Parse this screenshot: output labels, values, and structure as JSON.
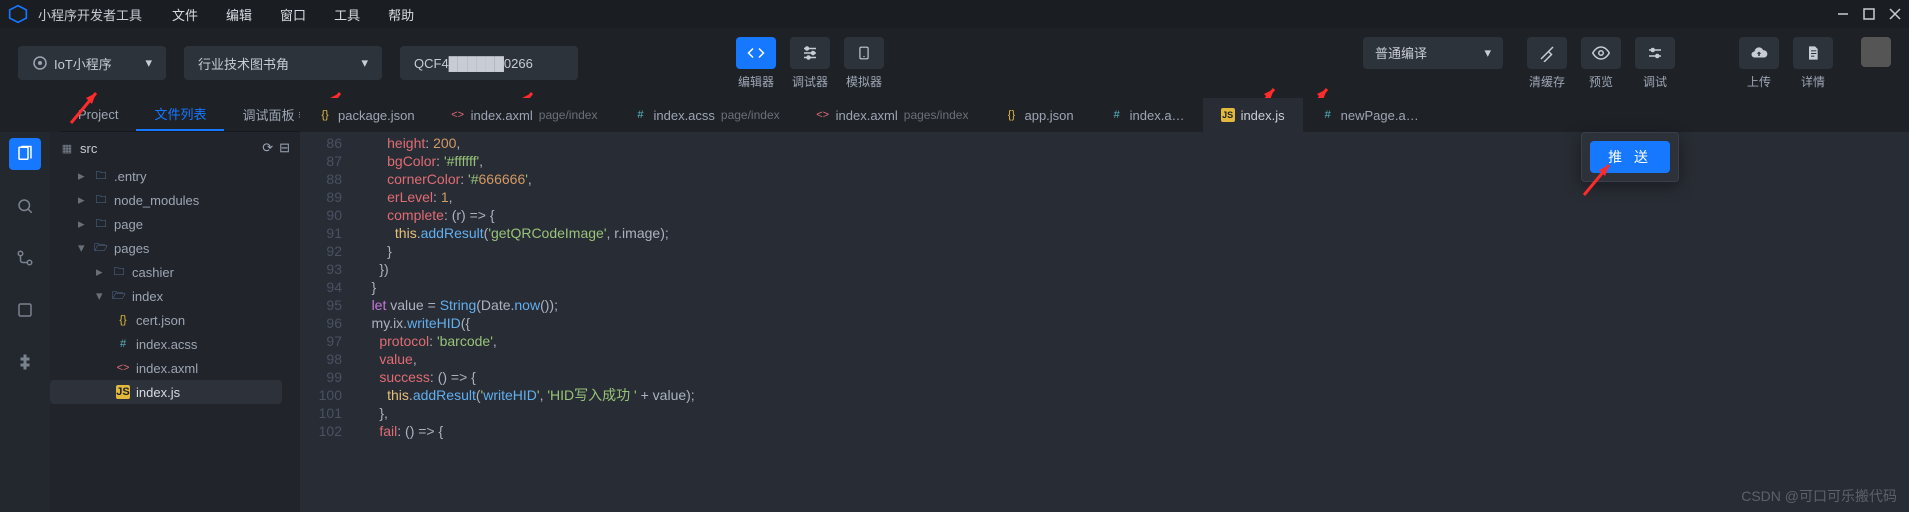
{
  "titlebar": {
    "title": "小程序开发者工具",
    "menus": [
      "文件",
      "编辑",
      "窗口",
      "工具",
      "帮助"
    ]
  },
  "toolbar": {
    "platform": "IoT小程序",
    "project": "行业技术图书角",
    "appid_masked": "QCF4██████0266",
    "center": [
      {
        "id": "editor",
        "label": "编辑器",
        "primary": true
      },
      {
        "id": "debugger",
        "label": "调试器"
      },
      {
        "id": "simulator",
        "label": "模拟器"
      }
    ],
    "compile_mode": "普通编译",
    "right": [
      {
        "id": "clear-cache",
        "label": "清缓存"
      },
      {
        "id": "preview",
        "label": "预览"
      },
      {
        "id": "debug",
        "label": "调试"
      }
    ],
    "far": [
      {
        "id": "upload",
        "label": "上传"
      },
      {
        "id": "details",
        "label": "详情"
      }
    ]
  },
  "proj_tabs": {
    "project": "Project",
    "filelist": "文件列表",
    "debugpanel": "调试面板"
  },
  "editor_tabs": [
    {
      "icon": "braces",
      "label": "package.json"
    },
    {
      "icon": "tag",
      "label": "index.axml",
      "sub": "page/index"
    },
    {
      "icon": "hash",
      "label": "index.acss",
      "sub": "page/index"
    },
    {
      "icon": "tag",
      "label": "index.axml",
      "sub": "pages/index"
    },
    {
      "icon": "braces",
      "label": "app.json"
    },
    {
      "icon": "hash",
      "label": "index.a…"
    },
    {
      "icon": "js",
      "label": "index.js",
      "active": true
    },
    {
      "icon": "hash",
      "label": "newPage.a…"
    }
  ],
  "file_tree": {
    "root": "src",
    "items": [
      {
        "d": 1,
        "type": "folder",
        "name": ".entry",
        "closed": true
      },
      {
        "d": 1,
        "type": "folder",
        "name": "node_modules",
        "closed": true
      },
      {
        "d": 1,
        "type": "folder",
        "name": "page",
        "closed": true
      },
      {
        "d": 1,
        "type": "folder",
        "name": "pages",
        "open": true
      },
      {
        "d": 2,
        "type": "folder",
        "name": "cashier",
        "closed": true
      },
      {
        "d": 2,
        "type": "folder",
        "name": "index",
        "open": true
      },
      {
        "d": 3,
        "type": "file",
        "icon": "braces",
        "name": "cert.json"
      },
      {
        "d": 3,
        "type": "file",
        "icon": "hash",
        "name": "index.acss"
      },
      {
        "d": 3,
        "type": "file",
        "icon": "tag",
        "name": "index.axml"
      },
      {
        "d": 3,
        "type": "file",
        "icon": "js",
        "name": "index.js",
        "selected": true
      }
    ]
  },
  "code": {
    "first_line": 86,
    "lines": [
      "        height: 200,",
      "        bgColor: '#ffffff',",
      "        cornerColor: '#666666',",
      "        erLevel: 1,",
      "        complete: (r) => {",
      "          this.addResult('getQRCodeImage', r.image);",
      "        }",
      "      })",
      "    }",
      "    let value = String(Date.now());",
      "    my.ix.writeHID({",
      "      protocol: 'barcode',",
      "      value,",
      "      success: () => {",
      "        this.addResult('writeHID', 'HID写入成功 ' + value);",
      "      },",
      "      fail: () => {"
    ]
  },
  "popover": {
    "push": "推 送"
  },
  "watermark": "CSDN @可口可乐搬代码"
}
